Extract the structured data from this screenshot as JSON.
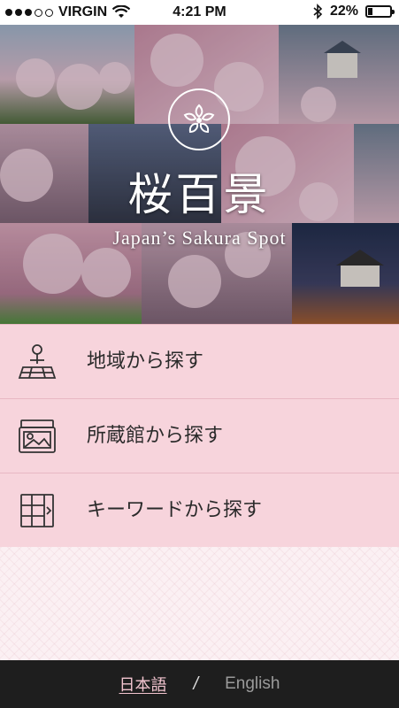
{
  "status_bar": {
    "carrier": "VIRGIN",
    "time": "4:21 PM",
    "battery": "22%",
    "battery_level": 0.22,
    "signal_bars": 3
  },
  "hero": {
    "title": "桜百景",
    "subtitle": "Japan’s Sakura Spot",
    "emblem_icon": "sakura-flower-icon"
  },
  "menu": {
    "items": [
      {
        "label": "地域から探す",
        "icon": "map-pin-icon"
      },
      {
        "label": "所蔵館から探す",
        "icon": "gallery-icon"
      },
      {
        "label": "キーワードから探す",
        "icon": "keyword-grid-icon"
      }
    ]
  },
  "footer": {
    "lang_ja": "日本語",
    "separator": "/",
    "lang_en": "English"
  },
  "colors": {
    "menu_bg": "#f7d4dc",
    "footer_bg": "#1e1e1e",
    "active_lang": "#f2c4cf"
  }
}
